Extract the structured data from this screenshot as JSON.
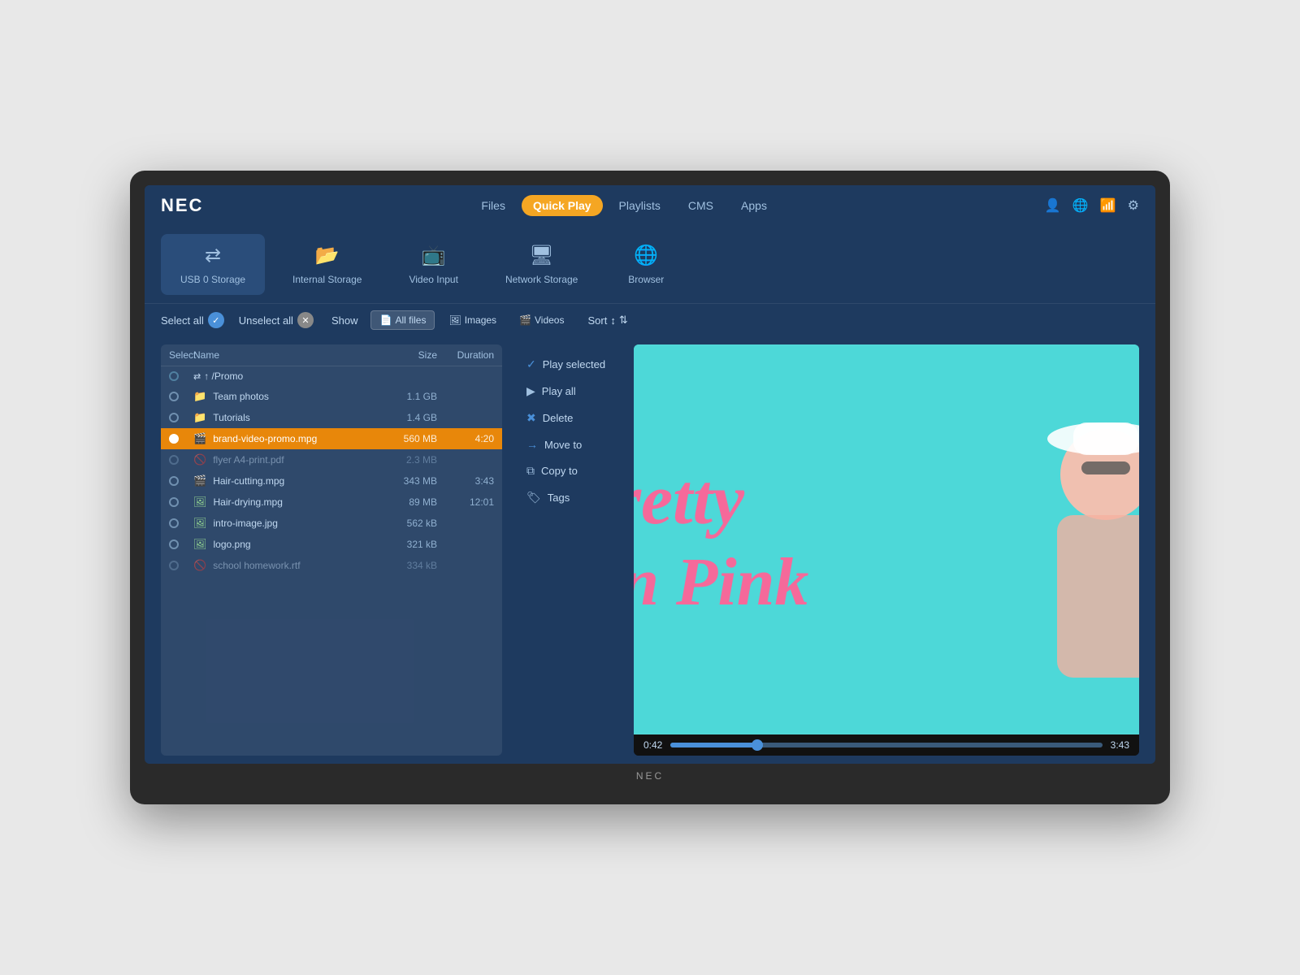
{
  "brand": "NEC",
  "brand_bottom": "NEC",
  "nav": {
    "items": [
      {
        "label": "Files",
        "active": false
      },
      {
        "label": "Quick Play",
        "active": true
      },
      {
        "label": "Playlists",
        "active": false
      },
      {
        "label": "CMS",
        "active": false
      },
      {
        "label": "Apps",
        "active": false
      }
    ]
  },
  "storage": {
    "items": [
      {
        "label": "USB 0 Storage",
        "icon": "usb",
        "active": true
      },
      {
        "label": "Internal Storage",
        "icon": "internal",
        "active": false
      },
      {
        "label": "Video Input",
        "icon": "video",
        "active": false
      },
      {
        "label": "Network Storage",
        "icon": "network",
        "active": false
      },
      {
        "label": "Browser",
        "icon": "browser",
        "active": false
      }
    ]
  },
  "toolbar": {
    "select_all": "Select all",
    "unselect_all": "Unselect all",
    "show": "Show",
    "all_files": "All files",
    "images": "Images",
    "videos": "Videos",
    "sort": "Sort"
  },
  "file_list": {
    "headers": [
      "Select",
      "Name",
      "Size",
      "Duration"
    ],
    "breadcrumb": "↑ /Promo",
    "files": [
      {
        "type": "folder",
        "name": "Team photos",
        "size": "1.1 GB",
        "duration": "",
        "selected": false,
        "disabled": false
      },
      {
        "type": "folder",
        "name": "Tutorials",
        "size": "1.4 GB",
        "duration": "",
        "selected": false,
        "disabled": false
      },
      {
        "type": "video",
        "name": "brand-video-promo.mpg",
        "size": "560 MB",
        "duration": "4:20",
        "selected": true,
        "disabled": false
      },
      {
        "type": "doc",
        "name": "flyer A4-print.pdf",
        "size": "2.3 MB",
        "duration": "",
        "selected": false,
        "disabled": true
      },
      {
        "type": "video",
        "name": "Hair-cutting.mpg",
        "size": "343 MB",
        "duration": "3:43",
        "selected": false,
        "disabled": false
      },
      {
        "type": "video",
        "name": "Hair-drying.mpg",
        "size": "89 MB",
        "duration": "12:01",
        "selected": false,
        "disabled": false
      },
      {
        "type": "image",
        "name": "intro-image.jpg",
        "size": "562 kB",
        "duration": "",
        "selected": false,
        "disabled": false
      },
      {
        "type": "image",
        "name": "logo.png",
        "size": "321 kB",
        "duration": "",
        "selected": false,
        "disabled": false
      },
      {
        "type": "doc",
        "name": "school homework.rtf",
        "size": "334 kB",
        "duration": "",
        "selected": false,
        "disabled": true
      }
    ]
  },
  "context_menu": {
    "items": [
      {
        "icon": "✓",
        "label": "Play selected"
      },
      {
        "icon": "▶",
        "label": "Play all"
      },
      {
        "icon": "✖",
        "label": "Delete"
      },
      {
        "icon": "→",
        "label": "Move to"
      },
      {
        "icon": "⧉",
        "label": "Copy to"
      },
      {
        "icon": "🏷",
        "label": "Tags"
      }
    ]
  },
  "video": {
    "title": "Pretty in Pink",
    "current_time": "0:42",
    "total_time": "3:43",
    "progress_percent": 20
  }
}
